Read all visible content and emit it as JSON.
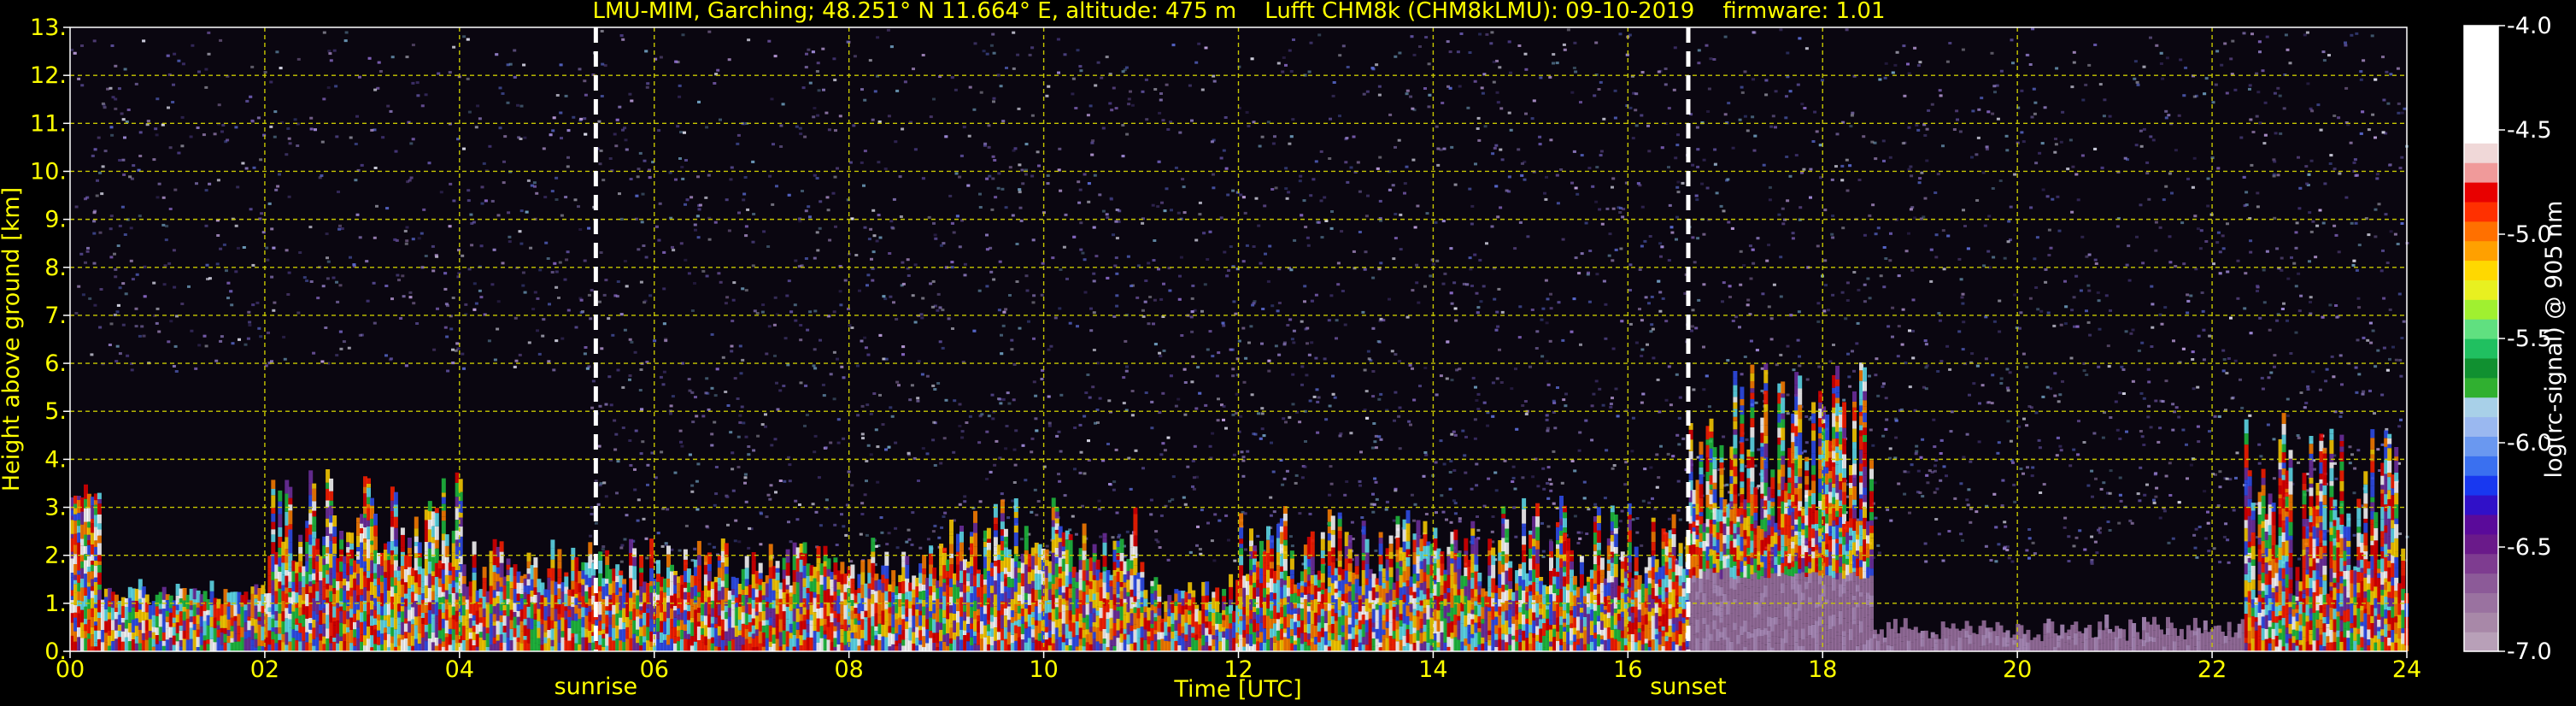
{
  "chart_data": {
    "type": "heatmap",
    "title": "LMU-MIM, Garching; 48.251° N 11.664° E, altitude: 475 m    Lufft CHM8k (CHM8kLMU): 09-10-2019    firmware: 1.01",
    "xlabel": "Time [UTC]",
    "ylabel": "Height above ground [km]",
    "xlim": [
      0,
      24
    ],
    "ylim": [
      0,
      13
    ],
    "x_ticks": [
      "00",
      "02",
      "04",
      "06",
      "08",
      "10",
      "12",
      "14",
      "16",
      "18",
      "20",
      "22",
      "24"
    ],
    "y_ticks": [
      "0.",
      "1.",
      "2.",
      "3.",
      "4.",
      "5.",
      "6.",
      "7.",
      "8.",
      "9.",
      "10.",
      "11.",
      "12.",
      "13."
    ],
    "grid": true,
    "colorbar": {
      "label": "log(rc-signal) @ 905 nm",
      "range": [
        -7.0,
        -4.0
      ],
      "ticks": [
        "-4.0",
        "-4.5",
        "-5.0",
        "-5.5",
        "-6.0",
        "-6.5",
        "-7.0"
      ],
      "colors": [
        "#b8a0b8",
        "#a888a8",
        "#9a72a0",
        "#8c5a98",
        "#7e3c90",
        "#6a1a8a",
        "#5a0a9a",
        "#3010c8",
        "#1838f0",
        "#3a70f0",
        "#6a98f0",
        "#9ab8f0",
        "#a8d0e8",
        "#30b030",
        "#109030",
        "#20c060",
        "#60e080",
        "#a0f030",
        "#e8f020",
        "#ffd800",
        "#ffa000",
        "#ff7000",
        "#ff3000",
        "#e80000",
        "#f09a9a",
        "#f0d8d8",
        "#ffffff",
        "#ffffff",
        "#ffffff",
        "#ffffff",
        "#ffffff",
        "#ffffff"
      ]
    },
    "annotations": [
      {
        "text": "sunrise",
        "x": 5.4
      },
      {
        "text": "sunset",
        "x": 16.62
      }
    ],
    "colors": {
      "axis_text": "#ffff00",
      "grid": "#c8c800",
      "background": "#000000",
      "sun_lines": "#ffffff"
    }
  }
}
